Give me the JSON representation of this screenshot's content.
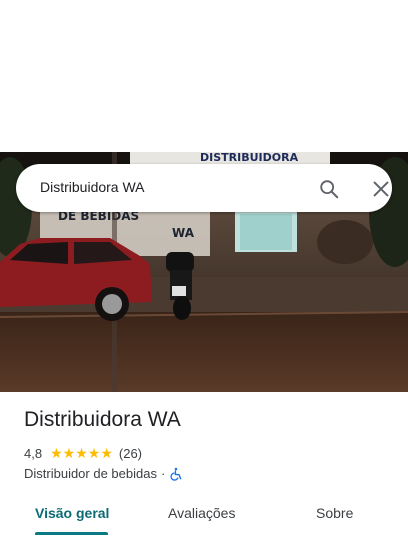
{
  "search": {
    "value": "Distribuidora WA"
  },
  "place": {
    "name": "Distribuidora WA",
    "rating": "4,8",
    "stars": 5,
    "review_count": "(26)",
    "category": "Distribuidor de bebidas",
    "separator": "·"
  },
  "photo": {
    "sign_text": "DISTRIBUIDORA",
    "wall_text": "DE BEBIDAS",
    "wall_logo": "WA"
  },
  "tabs": [
    {
      "label": "Visão geral",
      "selected": true
    },
    {
      "label": "Avaliações",
      "selected": false
    },
    {
      "label": "Sobre",
      "selected": false
    }
  ],
  "colors": {
    "accent": "#0b7a84",
    "star": "#fbbc04",
    "wheelchair": "#1a73e8"
  },
  "icons": [
    "search-icon",
    "close-icon",
    "star-icon",
    "wheelchair-icon"
  ]
}
